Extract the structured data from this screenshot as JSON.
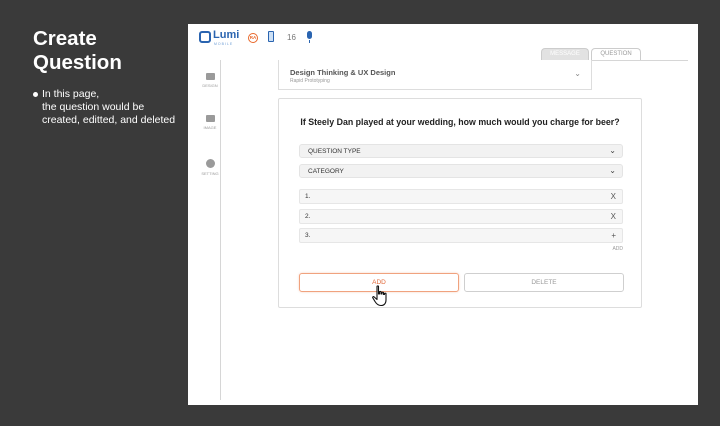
{
  "slide": {
    "title_line1": "Create",
    "title_line2": "Question",
    "note_lines": [
      "In this page,",
      "the question would be",
      "created, editted, and deleted"
    ]
  },
  "topbar": {
    "logo_text": "Lumi",
    "logo_sub": "MOBILE",
    "badge_text": "RA",
    "count": "16"
  },
  "tabs": {
    "message": "MESSAGE",
    "question": "QUESTION"
  },
  "sidebar": {
    "items": [
      {
        "label": "DESIGN"
      },
      {
        "label": "IMAGE"
      },
      {
        "label": "SETTING"
      }
    ]
  },
  "header_card": {
    "title": "Design Thinking & UX Design",
    "subtitle": "Rapid Prototyping"
  },
  "question": {
    "text": "If Steely Dan played at your wedding, how much would you charge for beer?",
    "type_select": "QUESTION TYPE",
    "category_select": "CATEGORY",
    "answers": [
      {
        "label": "1.",
        "action": "X"
      },
      {
        "label": "2.",
        "action": "X"
      },
      {
        "label": "3.",
        "action": "+"
      }
    ],
    "add_small": "ADD",
    "add_button": "ADD",
    "delete_button": "DELETE"
  },
  "icons": [
    "chevron-down-icon",
    "microphone-icon",
    "device-icon",
    "folder-icon",
    "image-icon",
    "gear-icon",
    "hand-cursor-icon"
  ],
  "colors": {
    "accent": "#e9692c",
    "brand_blue": "#2a64b0",
    "background": "#3a3a3a"
  }
}
